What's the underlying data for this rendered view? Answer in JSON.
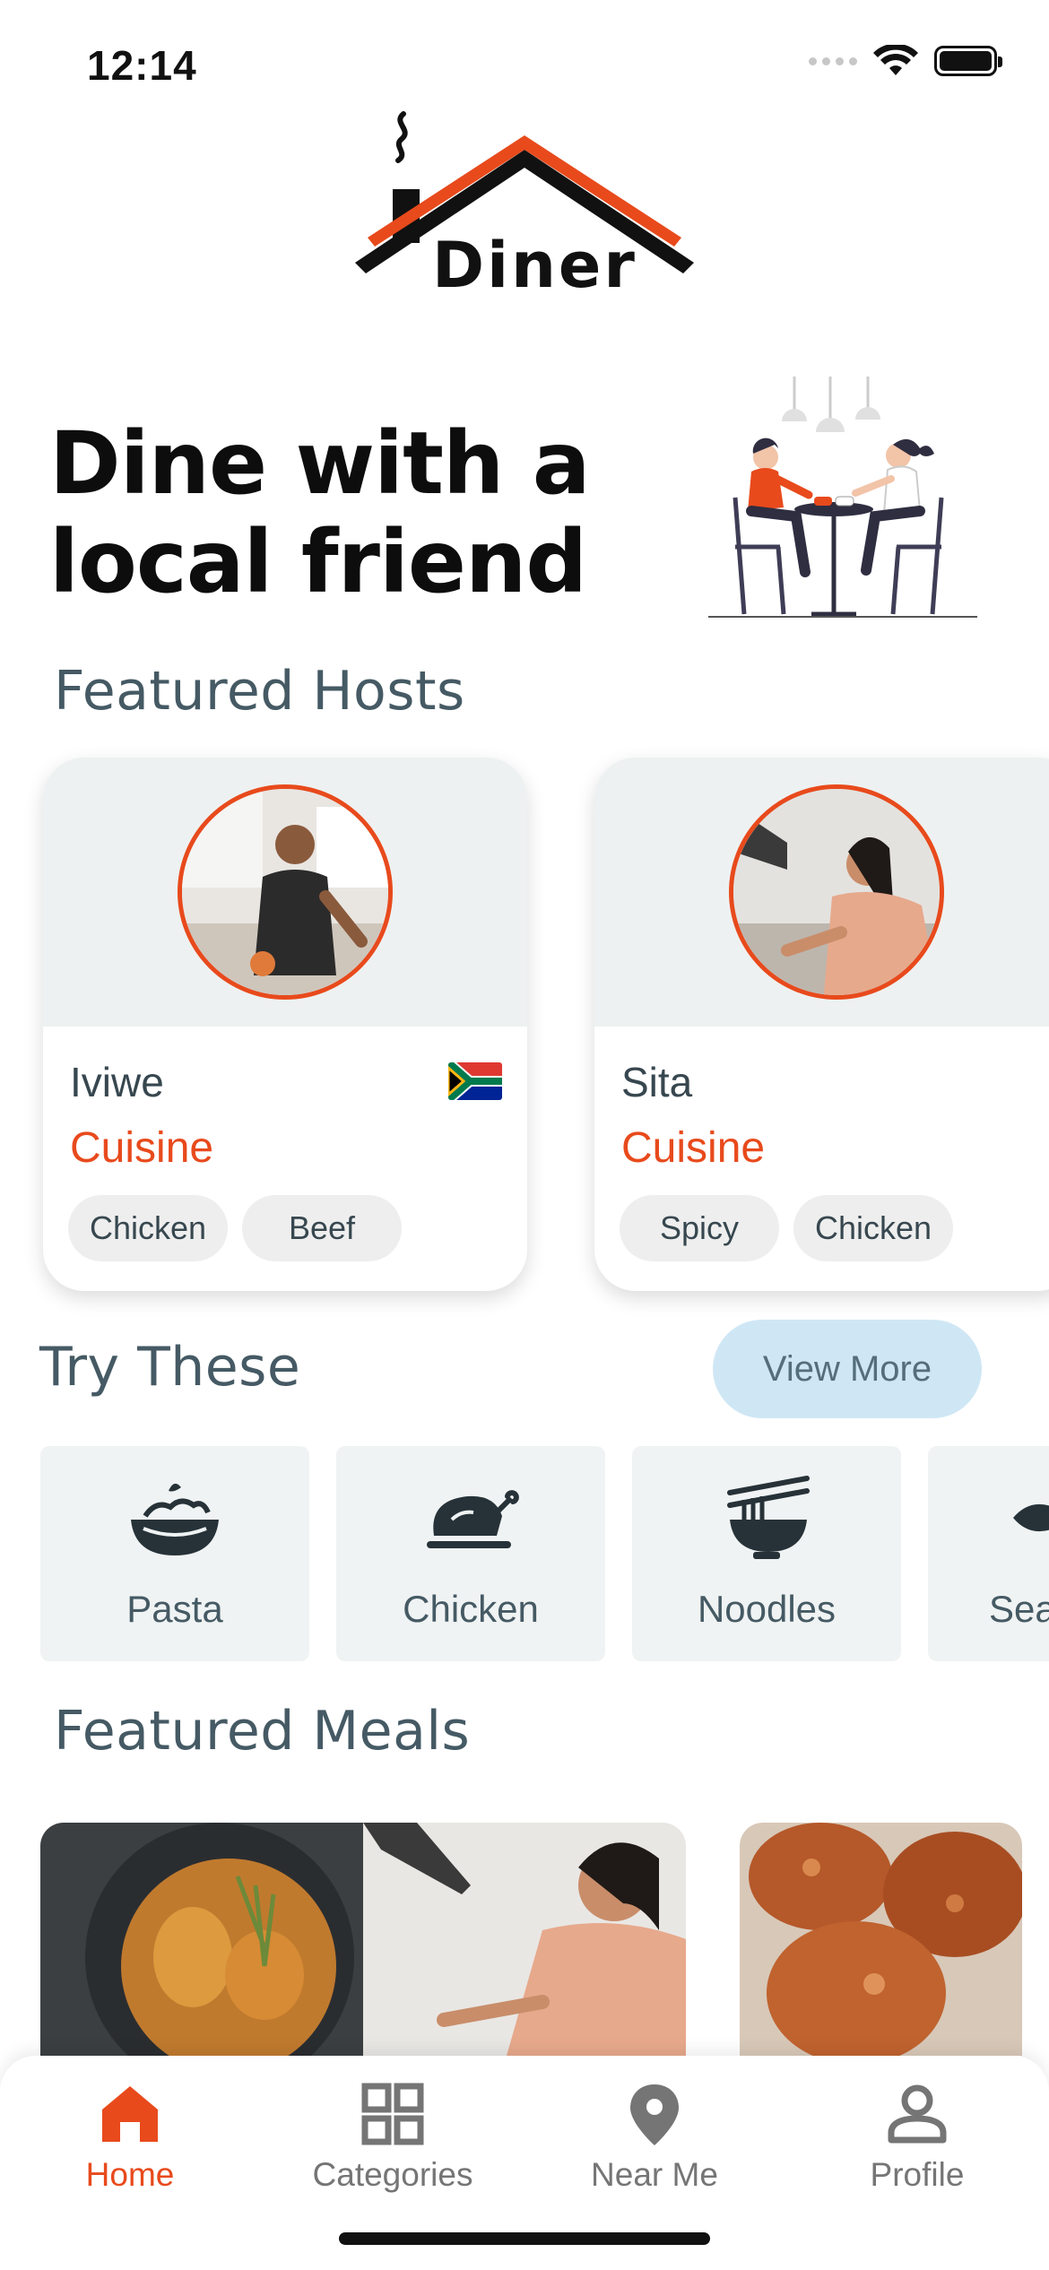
{
  "status_bar": {
    "time": "12:14"
  },
  "logo": {
    "text": "Diner"
  },
  "hero": {
    "title_line1": "Dine with a",
    "title_line2": "local friend"
  },
  "featured_hosts": {
    "title": "Featured Hosts",
    "hosts": [
      {
        "name": "Iviwe",
        "cuisine_label": "Cuisine",
        "tags": [
          "Chicken",
          "Beef"
        ]
      },
      {
        "name": "Sita",
        "cuisine_label": "Cuisine",
        "tags": [
          "Spicy",
          "Chicken"
        ]
      }
    ]
  },
  "try_these": {
    "title": "Try These",
    "view_more": "View More",
    "categories": [
      {
        "label": "Pasta",
        "icon": "pasta-icon"
      },
      {
        "label": "Chicken",
        "icon": "chicken-icon"
      },
      {
        "label": "Noodles",
        "icon": "noodles-icon"
      },
      {
        "label": "Sea",
        "icon": "seafood-icon"
      }
    ]
  },
  "featured_meals": {
    "title": "Featured Meals"
  },
  "bottom_nav": {
    "items": [
      {
        "label": "Home",
        "icon": "home-icon",
        "active": true
      },
      {
        "label": "Categories",
        "icon": "grid-icon",
        "active": false
      },
      {
        "label": "Near Me",
        "icon": "location-pin-icon",
        "active": false
      },
      {
        "label": "Profile",
        "icon": "person-icon",
        "active": false
      }
    ]
  },
  "colors": {
    "accent": "#e84a1c",
    "heading": "#455a64",
    "view_more_bg": "#cfe7f5",
    "tile_bg": "#f0f3f3"
  }
}
